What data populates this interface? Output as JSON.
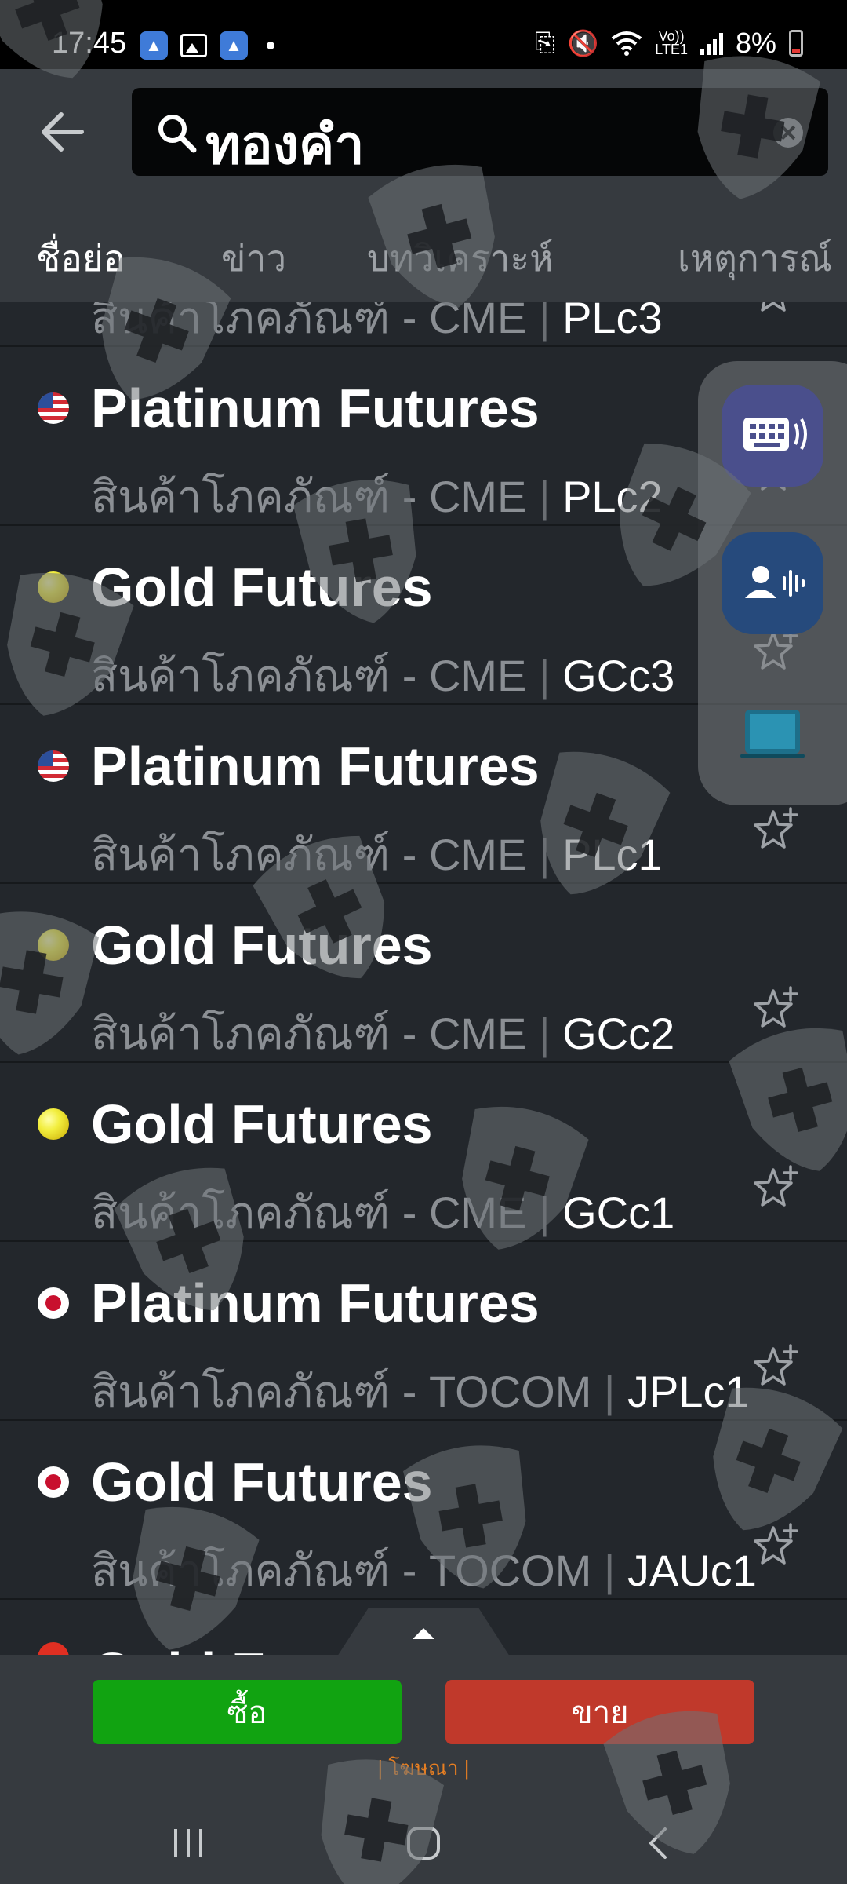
{
  "status_bar": {
    "time": "17:45",
    "network_label_1": "Vo))",
    "network_label_2": "LTE1",
    "battery": "8%",
    "icons": [
      "app-icon",
      "gallery-icon",
      "app-icon",
      "dot-icon",
      "clipboard-icon",
      "mute-icon",
      "wifi-icon",
      "signal-icon",
      "battery-icon"
    ]
  },
  "search": {
    "query": "ทองคำ",
    "icons": [
      "back-arrow-icon",
      "search-icon",
      "clear-icon"
    ]
  },
  "tabs": [
    {
      "label": "ชื่อย่อ",
      "active": true
    },
    {
      "label": "ข่าว",
      "active": false
    },
    {
      "label": "บทวิเคราะห์",
      "active": false
    },
    {
      "label": "เหตุการณ์",
      "active": false
    }
  ],
  "results": [
    {
      "title": "",
      "category": "สินค้าโภคภัณฑ์",
      "exchange": "CME",
      "symbol": "PLc3",
      "flag": "us"
    },
    {
      "title": "Platinum Futures",
      "category": "สินค้าโภคภัณฑ์",
      "exchange": "CME",
      "symbol": "PLc2",
      "flag": "us"
    },
    {
      "title": "Gold Futures",
      "category": "สินค้าโภคภัณฑ์",
      "exchange": "CME",
      "symbol": "GCc3",
      "flag": "gold"
    },
    {
      "title": "Platinum Futures",
      "category": "สินค้าโภคภัณฑ์",
      "exchange": "CME",
      "symbol": "PLc1",
      "flag": "us"
    },
    {
      "title": "Gold Futures",
      "category": "สินค้าโภคภัณฑ์",
      "exchange": "CME",
      "symbol": "GCc2",
      "flag": "gold"
    },
    {
      "title": "Gold Futures",
      "category": "สินค้าโภคภัณฑ์",
      "exchange": "CME",
      "symbol": "GCc1",
      "flag": "gold"
    },
    {
      "title": "Platinum Futures",
      "category": "สินค้าโภคภัณฑ์",
      "exchange": "TOCOM",
      "symbol": "JPLc1",
      "flag": "jp"
    },
    {
      "title": "Gold Futures",
      "category": "สินค้าโภคภัณฑ์",
      "exchange": "TOCOM",
      "symbol": "JAUc1",
      "flag": "jp"
    }
  ],
  "partial_row": {
    "title": "Gold Fut",
    "flag": "vn"
  },
  "side_panel": {
    "icons": [
      "keyboard-voice-icon",
      "voice-assistant-icon",
      "screen-icon"
    ]
  },
  "bottom": {
    "buy_label": "ซื้อ",
    "sell_label": "ขาย",
    "ad_label": "| โฆษณา |",
    "nav_icons": [
      "recents-icon",
      "home-icon",
      "back-icon"
    ]
  },
  "colors": {
    "background": "#23272c",
    "header": "#363a3f",
    "buy": "#11a311",
    "sell": "#c0392b",
    "ad_label": "#e67e22",
    "subtext": "#8b8f94"
  }
}
